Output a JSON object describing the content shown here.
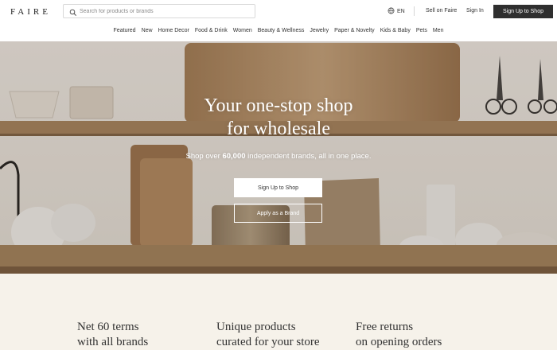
{
  "header": {
    "logo": "FAIRE",
    "search": {
      "placeholder": "Search for products or brands",
      "value": "",
      "icon": "search-icon"
    },
    "language": "EN",
    "language_icon": "globe-icon",
    "sell_label": "Sell on Faire",
    "signin_label": "Sign In",
    "signup_label": "Sign Up to Shop"
  },
  "nav": {
    "items": [
      {
        "label": "Featured"
      },
      {
        "label": "New"
      },
      {
        "label": "Home Decor"
      },
      {
        "label": "Food & Drink"
      },
      {
        "label": "Women"
      },
      {
        "label": "Beauty & Wellness"
      },
      {
        "label": "Jewelry"
      },
      {
        "label": "Paper & Novelty"
      },
      {
        "label": "Kids & Baby"
      },
      {
        "label": "Pets"
      },
      {
        "label": "Men"
      }
    ]
  },
  "hero": {
    "title": "Your one-stop shop\nfor wholesale",
    "subtitle_pre": "Shop over ",
    "subtitle_count": "60,000",
    "subtitle_post": " independent brands, all in one place.",
    "primary_button": "Sign Up to Shop",
    "secondary_button": "Apply as a Brand"
  },
  "features": [
    {
      "text": "Net 60 terms\nwith all brands"
    },
    {
      "text": "Unique products\ncurated for your store"
    },
    {
      "text": "Free returns\non opening orders"
    }
  ],
  "colors": {
    "header_bg": "#ffffff",
    "dark_button": "#2f2f2f",
    "page_bg": "#f6f2ea",
    "hero_wall": "#ebe7e1",
    "shelf_wood": "#9d7e5a"
  }
}
